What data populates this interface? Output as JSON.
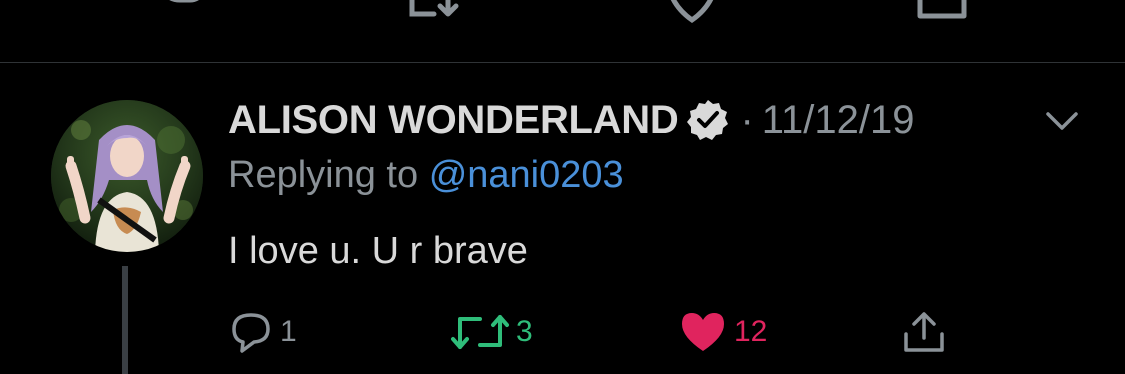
{
  "tweet": {
    "author_name": "ALISON WONDERLAND",
    "separator": "·",
    "date": "11/12/19",
    "replying_prefix": "Replying to",
    "replying_handle": "@nani0203",
    "text": "I love u. U r brave",
    "reply_count": "1",
    "retweet_count": "3",
    "like_count": "12",
    "liked": true,
    "retweeted": true
  },
  "icons": {
    "verified": "verified-badge-icon",
    "more": "chevron-down-icon",
    "reply": "reply-bubble-icon",
    "retweet": "retweet-icon",
    "like": "heart-icon",
    "share": "share-icon"
  },
  "colors": {
    "background": "#000000",
    "text": "#d9d9d9",
    "muted": "#8b9298",
    "link": "#4a90d9",
    "retweet_green": "#2fbd7a",
    "like_red": "#e0245e",
    "divider": "#2f3336"
  }
}
